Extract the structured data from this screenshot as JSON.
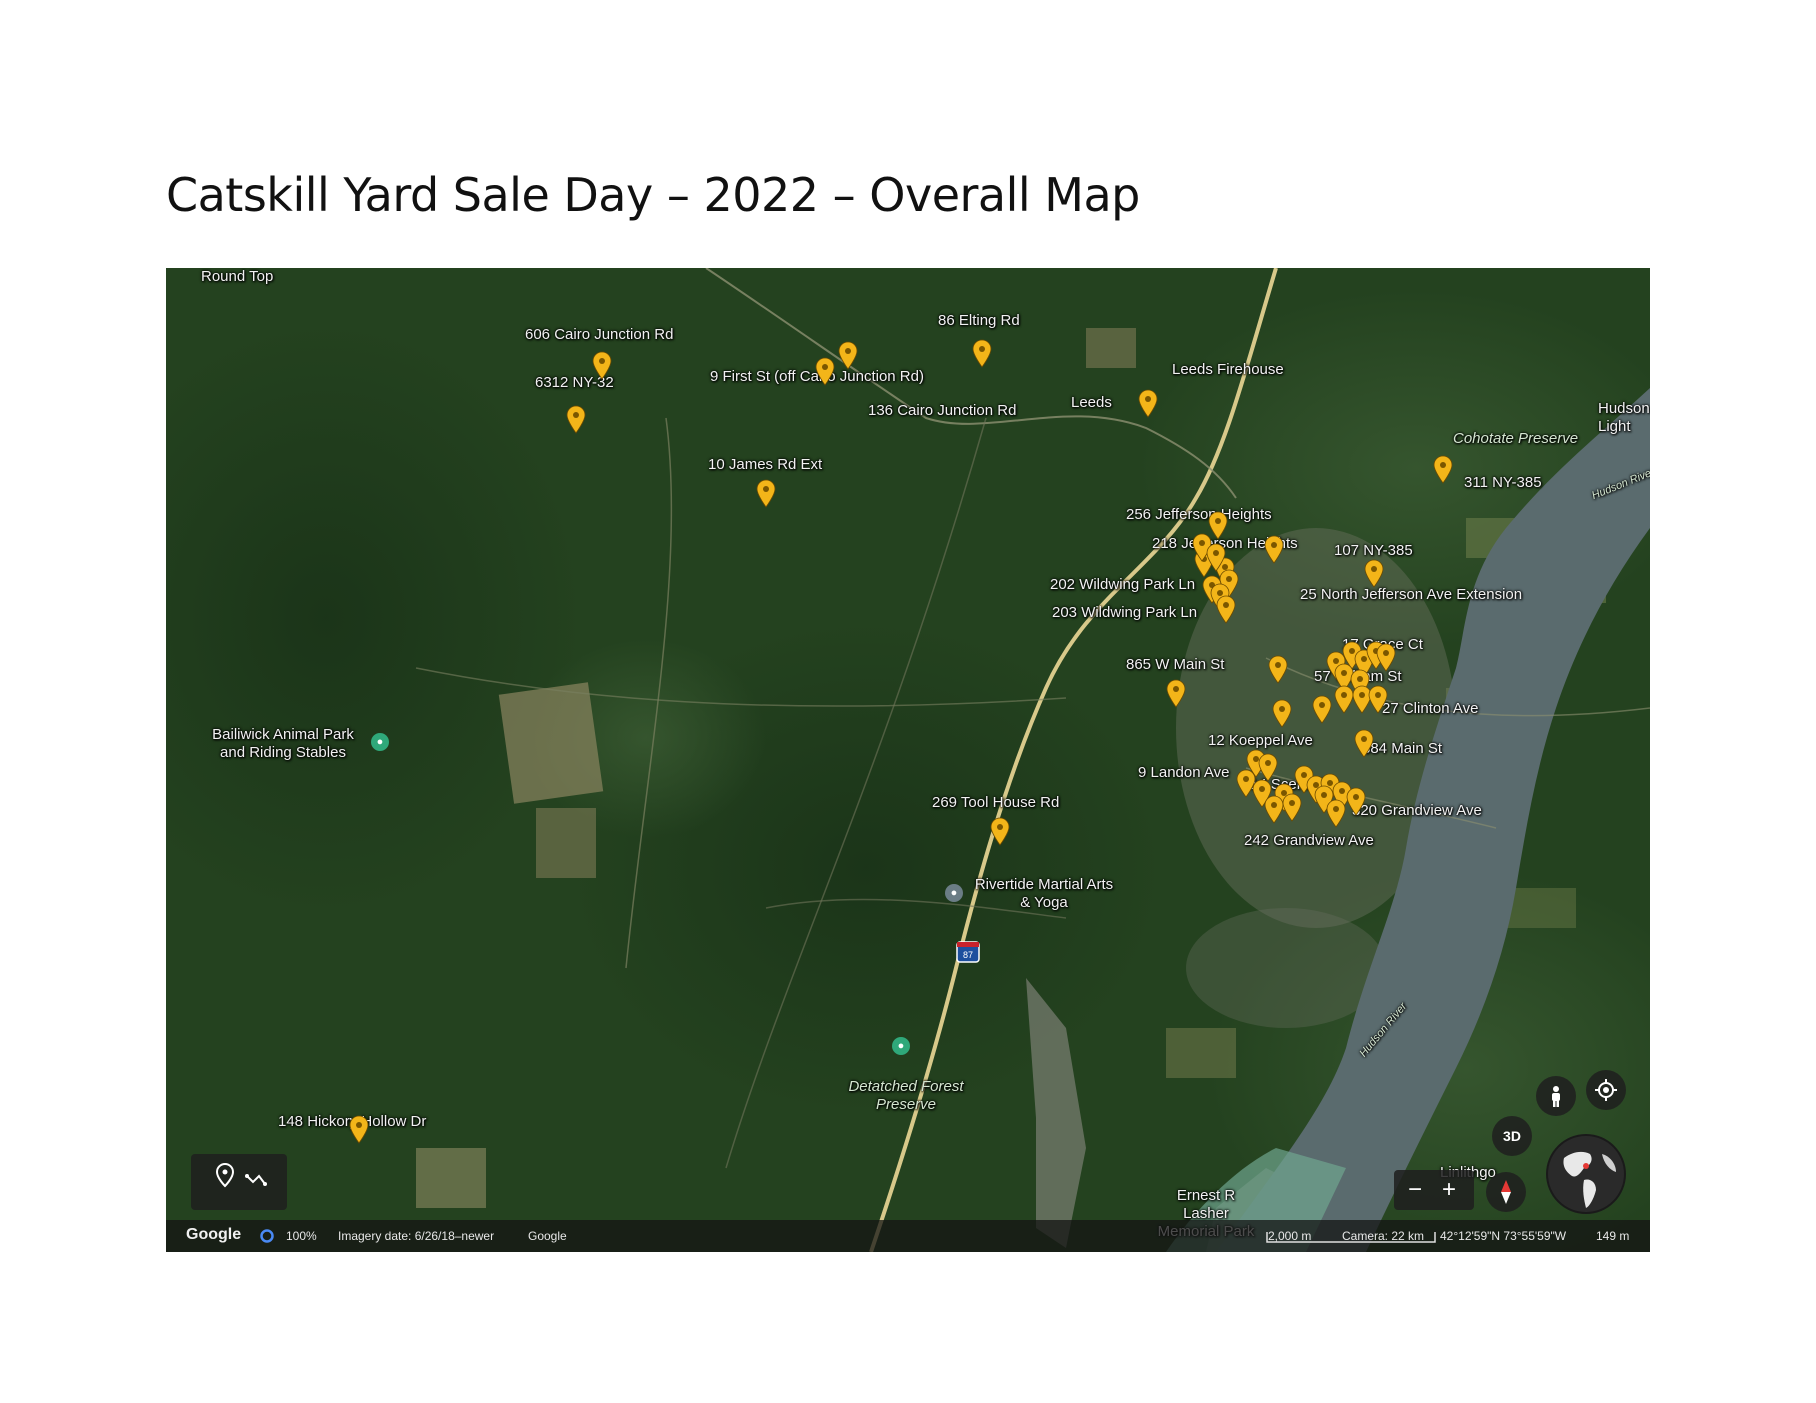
{
  "title": "Catskill Yard Sale Day – 2022 – Overall Map",
  "map_labels": {
    "round_top": "Round Top",
    "leeds": "Leeds",
    "leeds_firehouse": "Leeds Firehouse",
    "hudson_light": "Hudson Light",
    "cohotate": "Cohotate Preserve",
    "hudson_river_1": "Hudson River",
    "hudson_river_2": "Hudson River",
    "bailiwick": "Bailiwick Animal Park and Riding Stables",
    "rivertide": "Rivertide Martial Arts & Yoga",
    "detatched": "Detatched Forest Preserve",
    "ernest": "Ernest R Lasher Memorial Park",
    "linlithgo": "Linlithgo",
    "interstate": "87"
  },
  "sale_labels": {
    "l606": "606 Cairo Junction Rd",
    "l6312": "6312 NY-32",
    "l9first": "9 First St (off Cairo Junction Rd)",
    "l86": "86 Elting Rd",
    "l136": "136 Cairo Junction Rd",
    "l10": "10 James Rd Ext",
    "l311": "311 NY-385",
    "l256": "256 Jefferson Heights",
    "l218": "218 Jefferson Heights",
    "l107": "107 NY-385",
    "l202": "202 Wildwing Park Ln",
    "l203": "203 Wildwing Park Ln",
    "l25": "25 North Jefferson Ave Extension",
    "l17": "17 Grace Ct",
    "l865": "865 W Main St",
    "l57": "57 William St",
    "l27": "27 Clinton Ave",
    "l12": "12 Koeppel Ave",
    "l384": "384 Main St",
    "l9landon": "9 Landon Ave",
    "l14": "14 Scenic Dr",
    "l269": "269 Tool House Rd",
    "l320": "320 Grandview Ave",
    "l242": "242 Grandview Ave",
    "l148": "148 Hickory Hollow Dr"
  },
  "controls": {
    "three_d": "3D",
    "zoom_out": "−",
    "zoom_in": "+"
  },
  "status_bar": {
    "brand": "Google",
    "load": "100%",
    "imagery": "Imagery date: 6/26/18–newer",
    "data_source": "Google",
    "scale": "2,000 m",
    "camera": "Camera: 22 km",
    "coords": "42°12'59\"N 73°55'59\"W",
    "elevation": "149 m"
  },
  "colors": {
    "pin": "#f3b519",
    "pin_dot": "#7a5600",
    "forest": "#23401f",
    "river": "#5a6b6e",
    "road": "#d8c98a"
  }
}
